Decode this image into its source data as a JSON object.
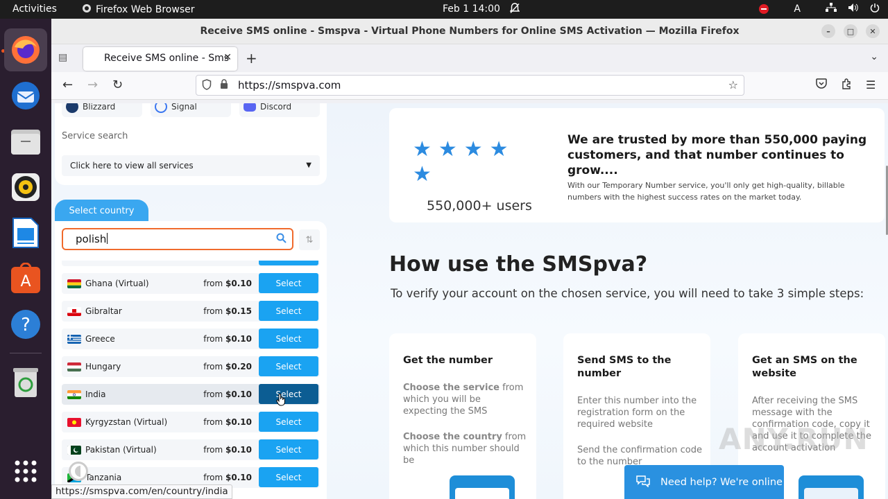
{
  "topbar": {
    "activities": "Activities",
    "app_name": "Firefox Web Browser",
    "clock": "Feb 1  14:00",
    "input_indicator": "A"
  },
  "dock": {
    "items": [
      "firefox",
      "thunderbird",
      "files",
      "rhythmbox",
      "libreoffice-writer",
      "app-center",
      "help",
      "trash",
      "show-apps"
    ]
  },
  "window": {
    "title": "Receive SMS online - Smspva - Virtual Phone Numbers for Online SMS Activation — Mozilla Firefox"
  },
  "tab": {
    "label": "Receive SMS online - Sms"
  },
  "urlbar": {
    "url": "https://smspva.com"
  },
  "left_panel": {
    "services": [
      {
        "name": "Blizzard",
        "color": "#1b3a6b"
      },
      {
        "name": "Signal",
        "color": "#3a76f0"
      },
      {
        "name": "Discord",
        "color": "#5865f2"
      }
    ],
    "service_search_label": "Service search",
    "service_dropdown": "Click here to view all services",
    "country_tab": "Select country",
    "search_value": "polish",
    "rows": [
      {
        "name": "Ghana (Virtual)",
        "from": "from",
        "price": "$0.10",
        "select": "Select",
        "flag": [
          "#ce1126",
          "#fcd116",
          "#006b3f"
        ]
      },
      {
        "name": "Gibraltar",
        "from": "from",
        "price": "$0.15",
        "select": "Select",
        "flag": [
          "#ffffff",
          "#ffffff",
          "#da000c"
        ]
      },
      {
        "name": "Greece",
        "from": "from",
        "price": "$0.10",
        "select": "Select",
        "flag": [
          "#0d5eaf",
          "#ffffff",
          "#0d5eaf"
        ]
      },
      {
        "name": "Hungary",
        "from": "from",
        "price": "$0.20",
        "select": "Select",
        "flag": [
          "#ce2939",
          "#ffffff",
          "#477050"
        ]
      },
      {
        "name": "India",
        "from": "from",
        "price": "$0.10",
        "select": "Select",
        "flag": [
          "#ff9933",
          "#ffffff",
          "#138808"
        ]
      },
      {
        "name": "Kyrgyzstan (Virtual)",
        "from": "from",
        "price": "$0.10",
        "select": "Select",
        "flag": [
          "#e8112d",
          "#e8112d",
          "#e8112d"
        ]
      },
      {
        "name": "Pakistan (Virtual)",
        "from": "from",
        "price": "$0.10",
        "select": "Select",
        "flag": [
          "#01411c",
          "#01411c",
          "#01411c"
        ]
      },
      {
        "name": "Tanzania",
        "from": "from",
        "price": "$0.10",
        "select": "Select",
        "flag": [
          "#1eb53a",
          "#000000",
          "#00a3dd"
        ]
      }
    ]
  },
  "trust": {
    "users": "550,000+ users",
    "heading": "We are trusted by more than 550,000 paying customers, and that number continues to grow....",
    "text": "With our Temporary Number service, you'll only get high-quality, billable numbers with the highest success rates on the market today."
  },
  "how": {
    "title": "How use the SMSpva?",
    "subtitle": "To verify your account on the chosen service, you will need to take 3 simple steps:"
  },
  "steps": [
    {
      "title": "Get the number",
      "p1_bold": "Choose the service",
      "p1_rest": " from which you will be expecting the SMS",
      "p2_bold": "Choose the country",
      "p2_rest": " from which this number should be"
    },
    {
      "title": "Send SMS to the number",
      "p1": "Enter this number into the registration form on the required website",
      "p2": "Send the confirmation code to the number"
    },
    {
      "title": "Get an SMS on the website",
      "p1": "After receiving the SMS message with the confirmation code, copy it and use it to complete the account activation"
    }
  ],
  "chat": {
    "label": "Need help? We're online"
  },
  "watermark": "ANY.RUN",
  "statusbar": {
    "url": "https://smspva.com/en/country/india"
  },
  "colors": {
    "accent": "#1aa3f2",
    "button_hover": "#0c5d93",
    "search_border": "#f06a2c",
    "star": "#2c8be0"
  }
}
